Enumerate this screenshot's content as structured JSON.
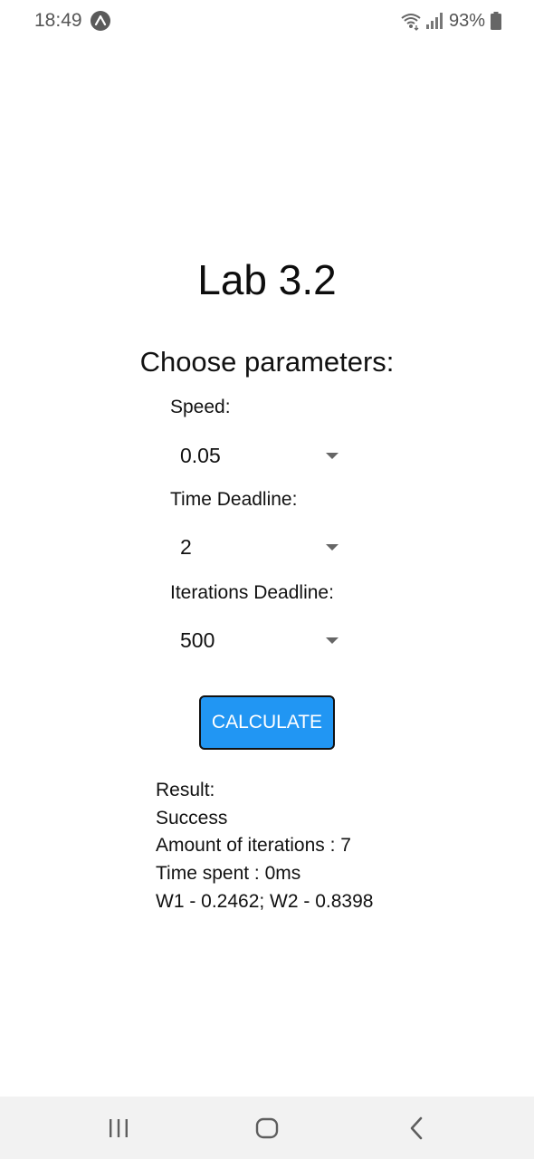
{
  "status_bar": {
    "time": "18:49",
    "app_icon": "app-notification-icon",
    "wifi_icon": "wifi-icon",
    "signal_icon": "signal-icon",
    "battery_percent": "93%",
    "battery_icon": "battery-icon"
  },
  "main": {
    "title": "Lab 3.2",
    "subtitle": "Choose parameters:",
    "fields": [
      {
        "label": "Speed:",
        "value": "0.05"
      },
      {
        "label": "Time Deadline:",
        "value": "2"
      },
      {
        "label": "Iterations Deadline:",
        "value": "500"
      }
    ],
    "calculate_label": "CALCULATE",
    "button_color": "#2196f3",
    "result": {
      "heading": "Result:",
      "status": "Success",
      "iterations": "Amount of iterations : 7",
      "time_spent": "Time spent : 0ms",
      "weights": "W1 - 0.2462; W2 - 0.8398"
    }
  },
  "nav_bar": {
    "recents_icon": "recent-apps-icon",
    "home_icon": "home-icon",
    "back_icon": "back-icon"
  }
}
